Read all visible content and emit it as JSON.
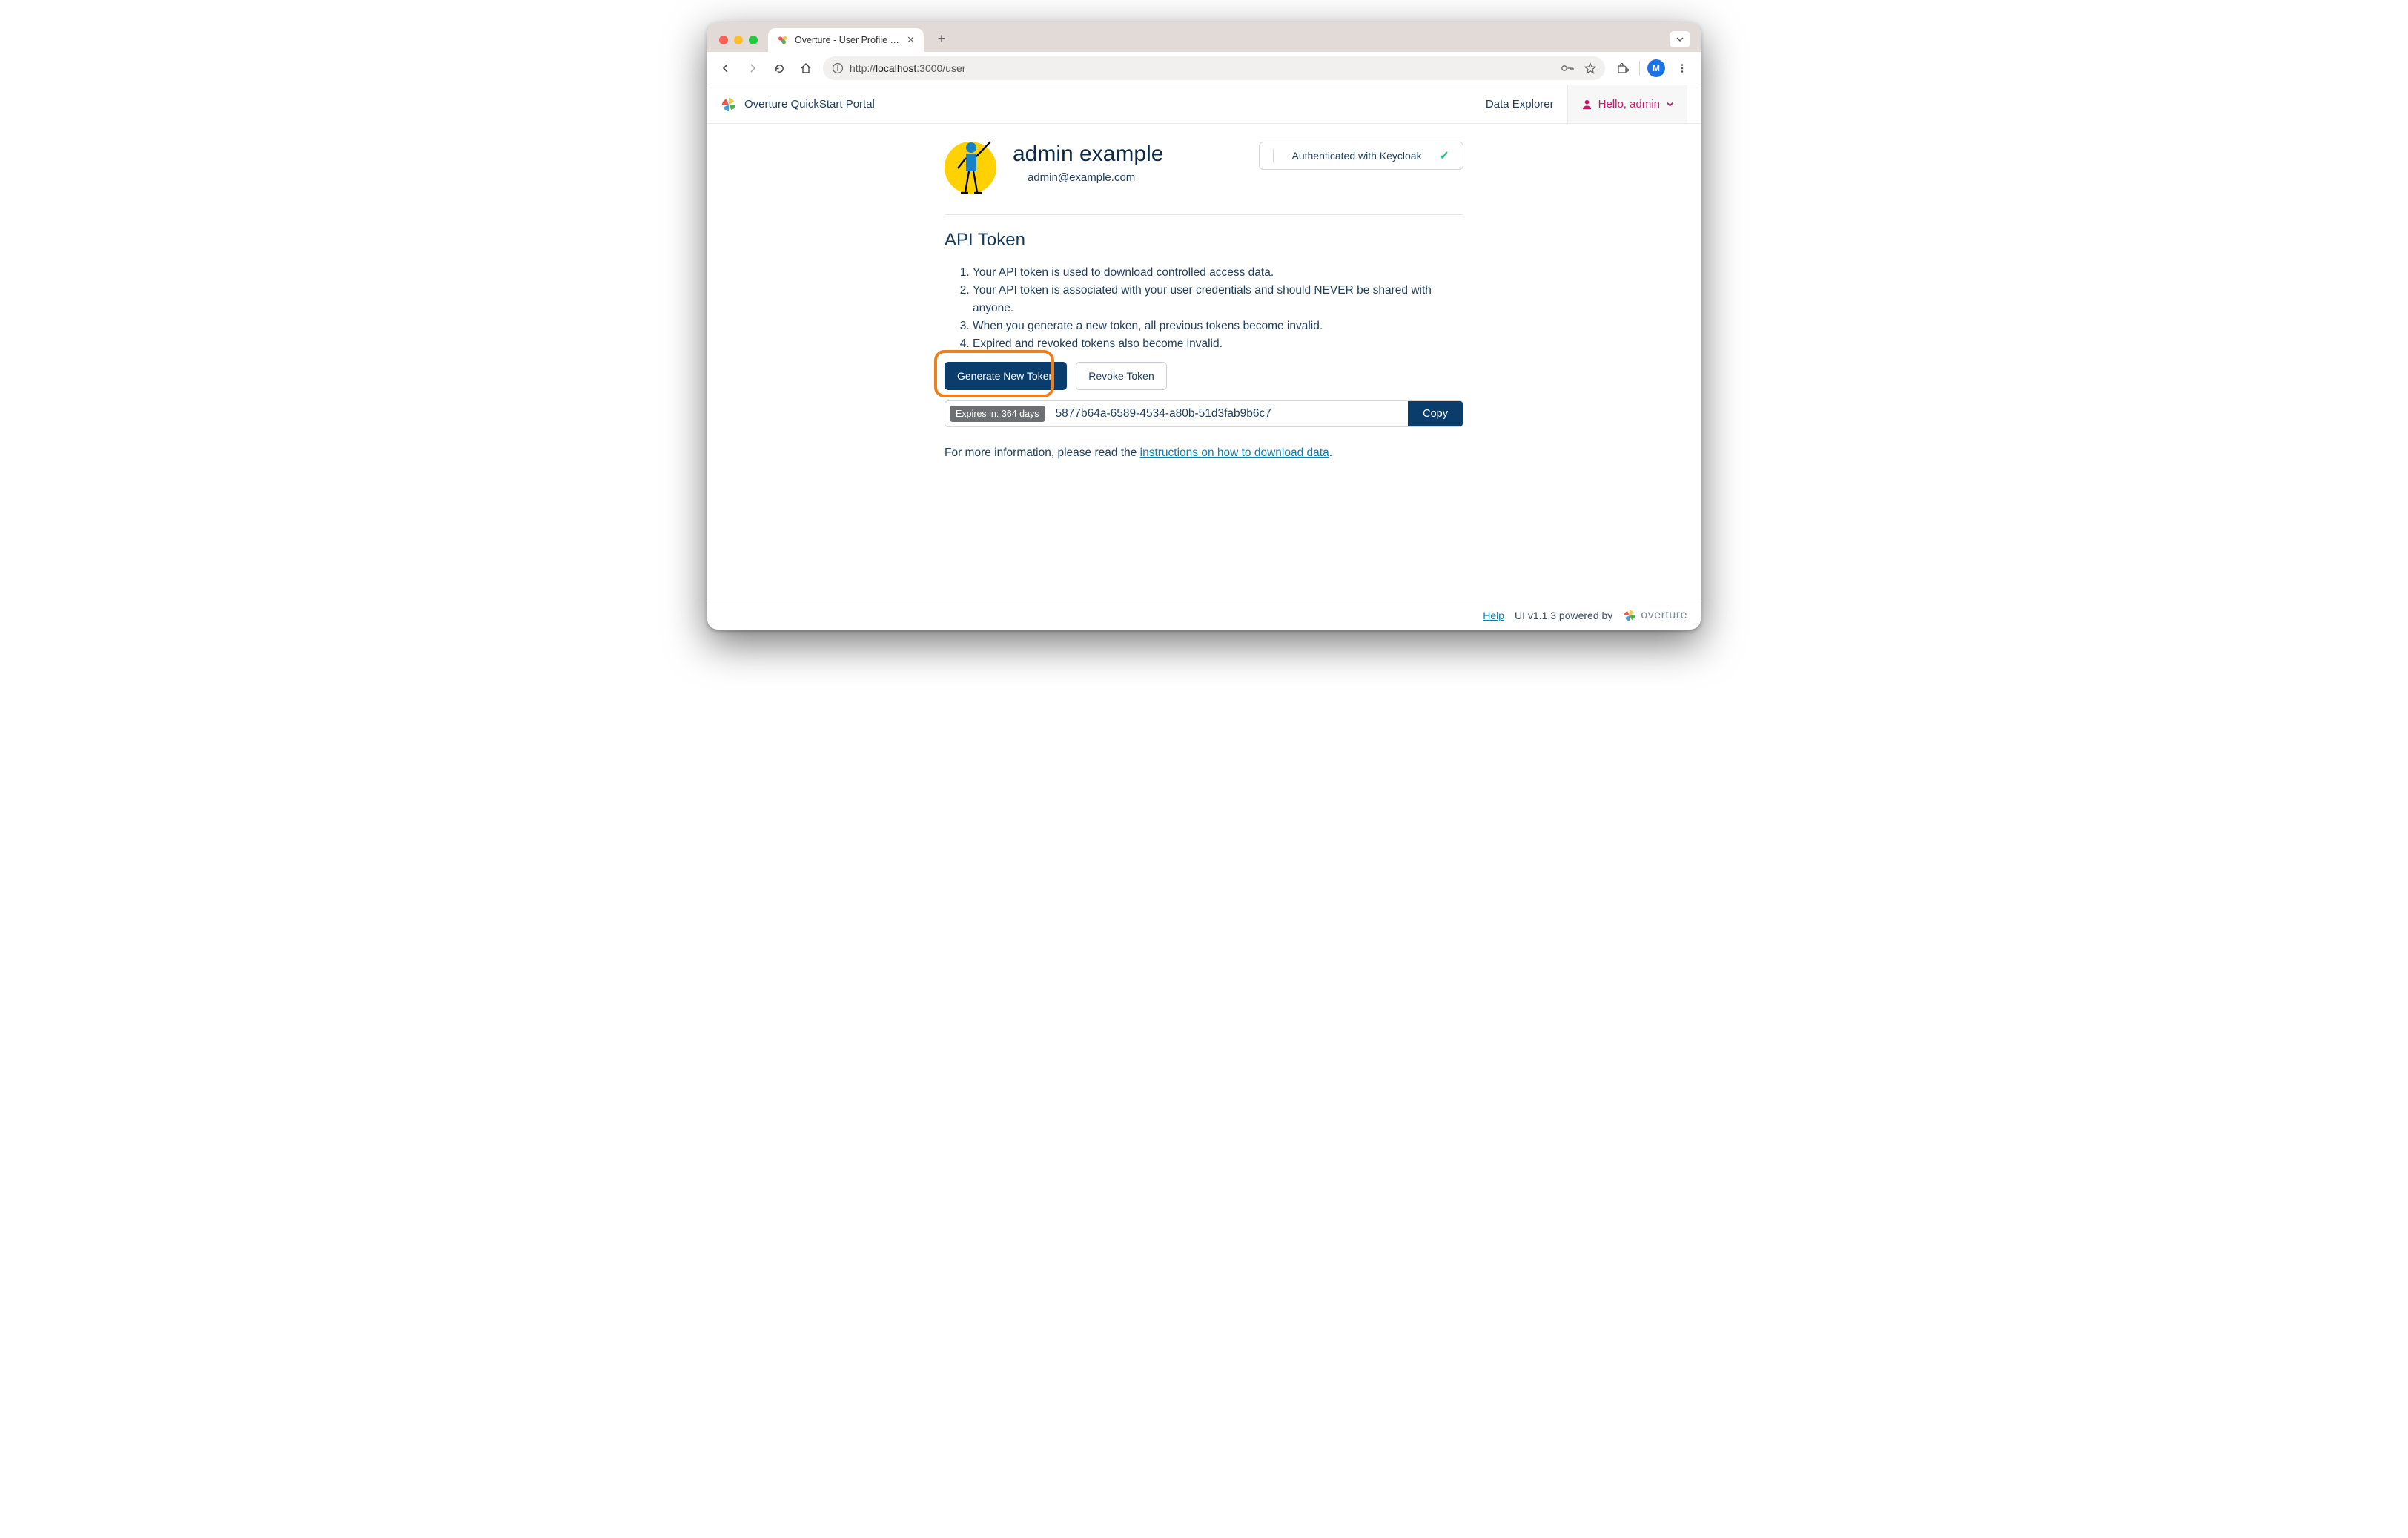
{
  "browser": {
    "tab_title": "Overture - User Profile & Tok",
    "url_prefix": "http://",
    "url_host": "localhost",
    "url_port_path": ":3000/user",
    "profile_initial": "M"
  },
  "header": {
    "brand": "Overture QuickStart Portal",
    "nav_data_explorer": "Data Explorer",
    "user_greeting": "Hello, admin"
  },
  "profile": {
    "name": "admin example",
    "email": "admin@example.com",
    "auth_badge": "Authenticated with Keycloak"
  },
  "api_token": {
    "heading": "API Token",
    "points": [
      "Your API token is used to download controlled access data.",
      "Your API token is associated with your user credentials and should NEVER be shared with anyone.",
      "When you generate a new token, all previous tokens become invalid.",
      "Expired and revoked tokens also become invalid."
    ],
    "generate_label": "Generate New Token",
    "revoke_label": "Revoke Token",
    "expiry_label": "Expires in: 364 days",
    "token_value": "5877b64a-6589-4534-a80b-51d3fab9b6c7",
    "copy_label": "Copy",
    "more_info_prefix": "For more information, please read the ",
    "more_info_link": "instructions on how to download data",
    "more_info_suffix": "."
  },
  "footer": {
    "help": "Help",
    "version": "UI v1.1.3 powered by",
    "brand_word": "overture"
  }
}
